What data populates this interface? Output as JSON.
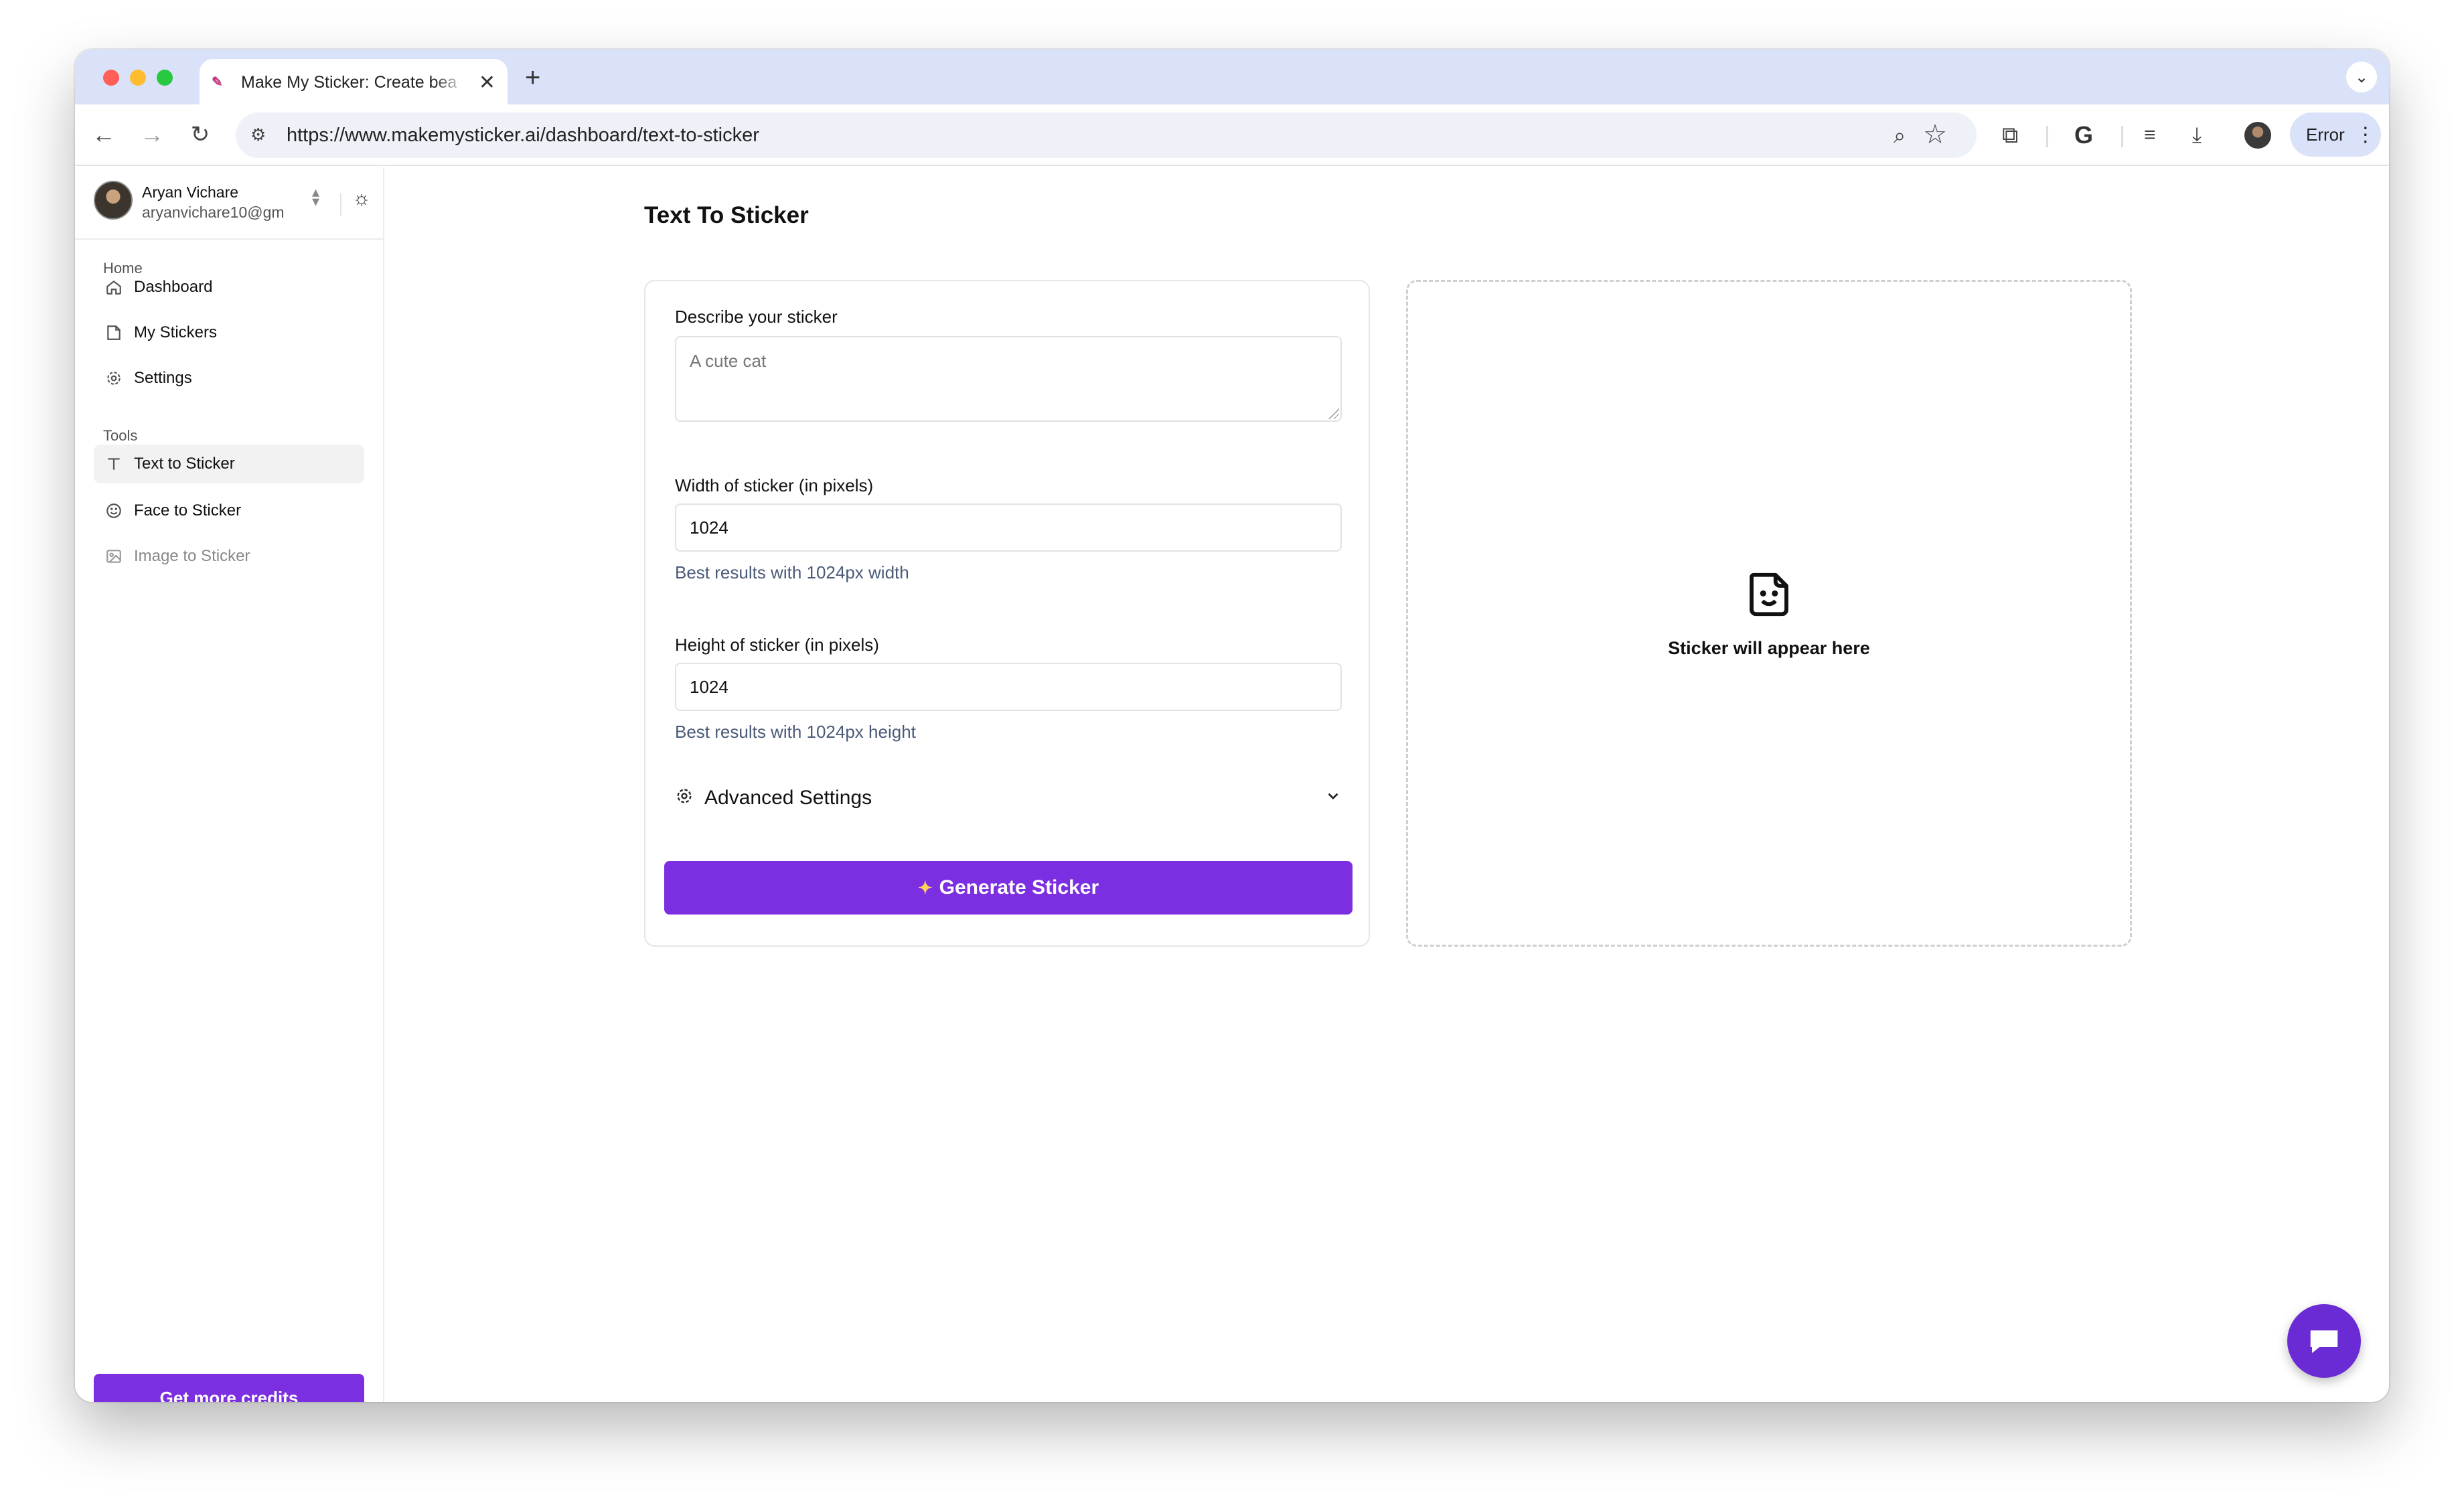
{
  "browser": {
    "tab_title": "Make My Sticker: Create bea",
    "url": "https://www.makemysticker.ai/dashboard/text-to-sticker",
    "profile_status": "Error",
    "colors": {
      "chrome_tabstrip": "#d9e2f8",
      "close": "#ff5f57",
      "minimize": "#febc2e",
      "maximize": "#28c840"
    }
  },
  "sidebar": {
    "user": {
      "name": "Aryan Vichare",
      "email": "aryanvichare10@gm"
    },
    "home_group": "Home",
    "home_items": [
      {
        "label": "Dashboard",
        "icon": "home-icon"
      },
      {
        "label": "My Stickers",
        "icon": "sticker-icon"
      },
      {
        "label": "Settings",
        "icon": "gear-icon"
      }
    ],
    "tools_group": "Tools",
    "tools_items": [
      {
        "label": "Text to Sticker",
        "icon": "text-icon",
        "active": true
      },
      {
        "label": "Face to Sticker",
        "icon": "smile-icon"
      },
      {
        "label": "Image to Sticker",
        "icon": "image-icon",
        "disabled": true
      }
    ],
    "credits_button": "Get more credits"
  },
  "main": {
    "title": "Text To Sticker",
    "form": {
      "describe_label": "Describe your sticker",
      "describe_placeholder": "A cute cat",
      "width_label": "Width of sticker (in pixels)",
      "width_value": "1024",
      "width_hint": "Best results with 1024px width",
      "height_label": "Height of sticker (in pixels)",
      "height_value": "1024",
      "height_hint": "Best results with 1024px height",
      "advanced_label": "Advanced Settings",
      "generate_label": "Generate Sticker"
    },
    "preview": {
      "placeholder_text": "Sticker will appear here"
    }
  },
  "accent_color": "#7c2fe0"
}
